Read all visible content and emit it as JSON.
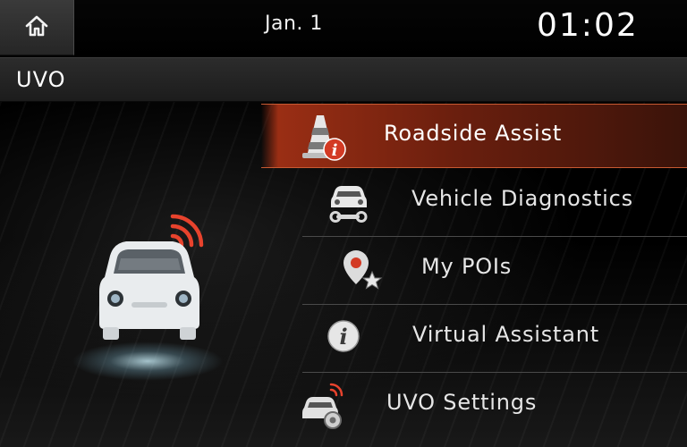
{
  "status_bar": {
    "home_icon": "home-icon",
    "date": "Jan. 1",
    "time": "01:02"
  },
  "title_bar": {
    "title": "UVO"
  },
  "menu": {
    "items": [
      {
        "label": "Roadside Assist",
        "icon": "roadside-assist-icon",
        "selected": true
      },
      {
        "label": "Vehicle Diagnostics",
        "icon": "vehicle-diagnostics-icon",
        "selected": false
      },
      {
        "label": "My POIs",
        "icon": "my-pois-icon",
        "selected": false
      },
      {
        "label": "Virtual Assistant",
        "icon": "virtual-assistant-icon",
        "selected": false
      },
      {
        "label": "UVO Settings",
        "icon": "uvo-settings-icon",
        "selected": false
      }
    ]
  },
  "illustration": {
    "icon": "connected-car-icon"
  },
  "colors": {
    "selected_accent": "#9a2e14",
    "signal_red": "#e8432d"
  }
}
